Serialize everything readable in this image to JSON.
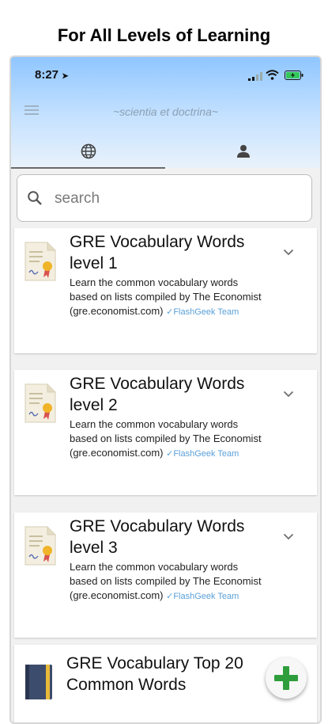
{
  "banner": "For All Levels of Learning",
  "status": {
    "time": "8:27"
  },
  "header": {
    "title": "~scientia et doctrina~"
  },
  "tabs": [
    {
      "icon": "globe-icon"
    },
    {
      "icon": "person-icon"
    }
  ],
  "search": {
    "placeholder": "search"
  },
  "decks": [
    {
      "title": "GRE Vocabulary Words level 1",
      "description": "Learn the common vocabulary words based on lists compiled by The Economist (gre.economist.com)",
      "author": "✓FlashGeek Team"
    },
    {
      "title": "GRE Vocabulary Words level 2",
      "description": "Learn the common vocabulary words based on lists compiled by The Economist (gre.economist.com)",
      "author": "✓FlashGeek Team"
    },
    {
      "title": "GRE Vocabulary Words level 3",
      "description": "Learn the common vocabulary words based on lists compiled by The Economist (gre.economist.com)",
      "author": "✓FlashGeek Team"
    },
    {
      "title": "GRE Vocabulary Top 20 Common Words"
    }
  ],
  "colors": {
    "accent": "#2e9e3c",
    "header_top": "#8fc6ff",
    "author": "#5aa0d9"
  }
}
